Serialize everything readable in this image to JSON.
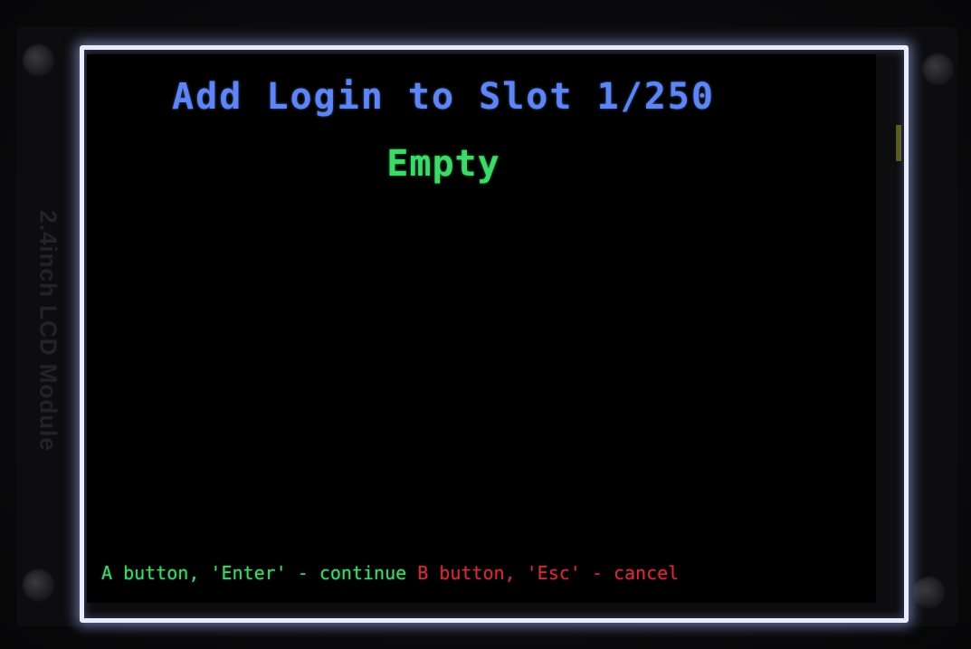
{
  "board": {
    "silkscreen_label": "2.4inch LCD Module"
  },
  "screen": {
    "title": "Add Login to Slot 1/250",
    "slot_status": "Empty",
    "footer": {
      "continue_hint": "A button, 'Enter' - continue",
      "cancel_hint": "B button, 'Esc' - cancel"
    }
  },
  "colors": {
    "background": "#000000",
    "title": "#5f85f5",
    "status": "#3fd96a",
    "continue_hint": "#49d36e",
    "cancel_hint": "#c8303a",
    "frame_glow": "#e8ecff"
  }
}
